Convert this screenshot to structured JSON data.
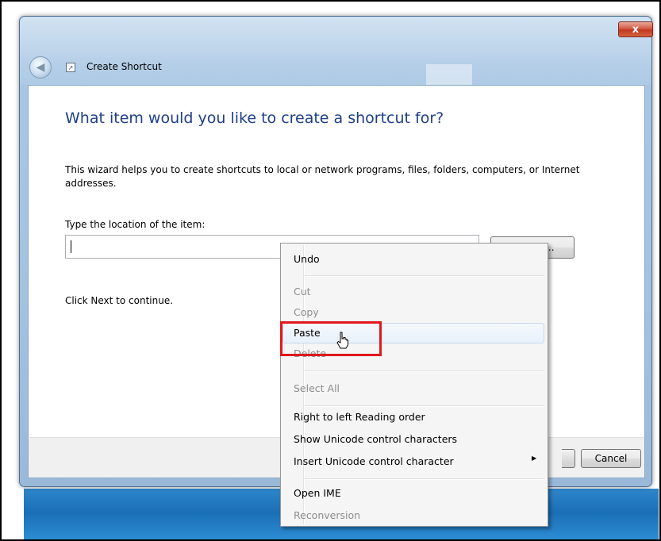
{
  "window": {
    "title": "Create Shortcut",
    "close_label": "x"
  },
  "page": {
    "heading": "What item would you like to create a shortcut for?",
    "description": "This wizard helps you to create shortcuts to local or network programs, files, folders, computers, or Internet addresses.",
    "location_label": "Type the location of the item:",
    "location_value": "",
    "browse_label": "Browse...",
    "click_next_text": "Click Next to continue."
  },
  "buttons": {
    "cancel_label": "Cancel"
  },
  "context_menu": {
    "items": [
      {
        "label": "Undo",
        "enabled": true
      },
      {
        "label": "Cut",
        "enabled": false
      },
      {
        "label": "Copy",
        "enabled": false
      },
      {
        "label": "Paste",
        "enabled": true,
        "hovered": true
      },
      {
        "label": "Delete",
        "enabled": false
      },
      {
        "label": "Select All",
        "enabled": false
      },
      {
        "label": "Right to left Reading order",
        "enabled": true
      },
      {
        "label": "Show Unicode control characters",
        "enabled": true
      },
      {
        "label": "Insert Unicode control character",
        "enabled": true,
        "submenu": true
      },
      {
        "label": "Open IME",
        "enabled": true
      },
      {
        "label": "Reconversion",
        "enabled": false
      }
    ]
  },
  "annotation": {
    "highlight_color": "#e0181c"
  },
  "colors": {
    "heading": "#1e3f8a",
    "window_frame": "#a9c7e4",
    "close_button": "#c0381f"
  }
}
